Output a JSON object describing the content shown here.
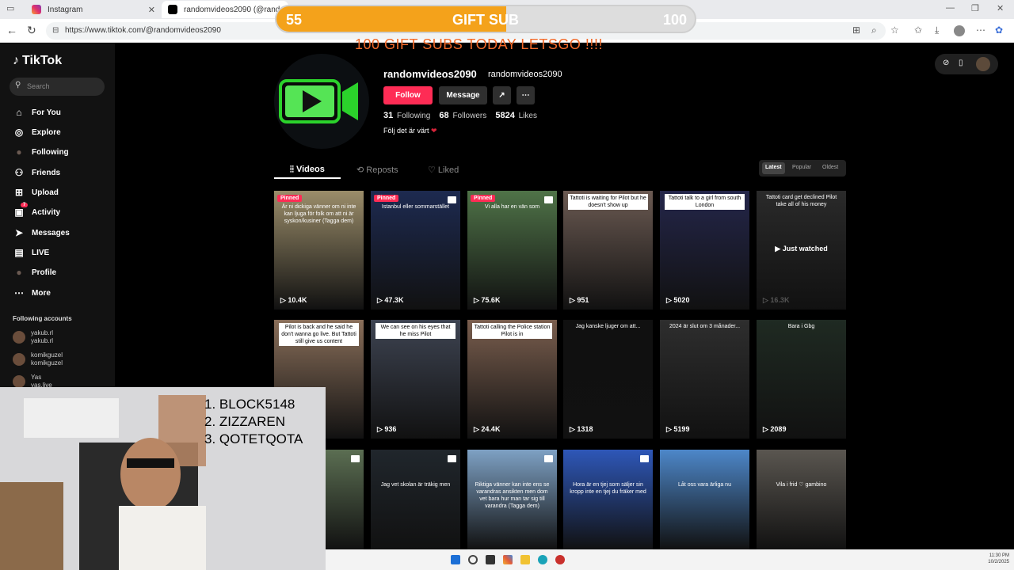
{
  "browser": {
    "tabs": [
      {
        "title": "Instagram"
      },
      {
        "title": "randomvideos2090 (@randomvi"
      }
    ],
    "url": "https://www.tiktok.com/@randomvideos2090"
  },
  "overlay": {
    "gift_start": "55",
    "gift_label": "GIFT SUB",
    "gift_goal": "100",
    "gift_progress_fraction": 0.55,
    "banner": "100 GIFT SUBS TODAY LETSGO !!!!"
  },
  "sidebar": {
    "logo": "TikTok",
    "search_placeholder": "Search",
    "items": [
      {
        "label": "For You",
        "icon": "home-icon"
      },
      {
        "label": "Explore",
        "icon": "compass-icon"
      },
      {
        "label": "Following",
        "icon": "following-icon"
      },
      {
        "label": "Friends",
        "icon": "friends-icon"
      },
      {
        "label": "Upload",
        "icon": "upload-icon"
      },
      {
        "label": "Activity",
        "icon": "activity-icon",
        "badge": "7"
      },
      {
        "label": "Messages",
        "icon": "messages-icon"
      },
      {
        "label": "LIVE",
        "icon": "live-icon"
      },
      {
        "label": "Profile",
        "icon": "avatar"
      },
      {
        "label": "More",
        "icon": "more-icon"
      }
    ],
    "following_header": "Following accounts",
    "accounts": [
      {
        "name": "yakub.rl",
        "handle": "yakub.rl"
      },
      {
        "name": "komikguzel",
        "handle": "komikguzel"
      },
      {
        "name": "Yas",
        "handle": "yas.live"
      }
    ]
  },
  "profile": {
    "name": "randomvideos2090",
    "username": "randomvideos2090",
    "follow_label": "Follow",
    "message_label": "Message",
    "following_count": "31",
    "following_label": "Following",
    "followers_count": "68",
    "followers_label": "Followers",
    "likes_count": "5824",
    "likes_label": "Likes",
    "bio": "Följ det är värt"
  },
  "tabs": [
    {
      "label": "Videos"
    },
    {
      "label": "Reposts"
    },
    {
      "label": "Liked"
    }
  ],
  "sort": [
    {
      "label": "Latest"
    },
    {
      "label": "Popular"
    },
    {
      "label": "Oldest"
    }
  ],
  "videos": [
    {
      "pinned": "Pinned",
      "caption": "Är ni dickiga vänner om ni inte kan ljuga för folk om att ni är syskon/kusiner (Tagga dem)",
      "views": "10.4K",
      "bg": "#9b8d6a"
    },
    {
      "pinned": "Pinned",
      "caption": "Istanbul eller sommarstället",
      "views": "47.3K",
      "bg": "#1d2a50"
    },
    {
      "pinned": "Pinned",
      "caption": "Vi alla har en vän som",
      "views": "75.6K",
      "bg": "#4f7348"
    },
    {
      "caption": "Tattoti is waiting for Pilot but he doesn't show up",
      "views": "951",
      "bg": "#6b5a52"
    },
    {
      "caption": "Tattoti talk to a girl from south London",
      "views": "5020",
      "bg": "#24264a"
    },
    {
      "caption": "Tattoti card get declined Pilot take all of his money",
      "overlay": "Just watched",
      "views": "16.3K",
      "bg": "#2a2a2a"
    },
    {
      "caption": "Pilot is back and he said he don't wanna go live. But Tattoti still give us content",
      "views": "",
      "bg": "#8a6f5a"
    },
    {
      "caption": "We can see on his eyes that he miss Pilot",
      "views": "936",
      "bg": "#3e4452"
    },
    {
      "caption": "Tattoti calling the Police station Pilot is in",
      "views": "24.4K",
      "bg": "#7a5e4e"
    },
    {
      "caption": "Jag kanske ljuger om att...",
      "views": "1318",
      "bg": "#101010"
    },
    {
      "caption": "2024 är slut om 3 månader...",
      "views": "5199",
      "bg": "#2e2e2e"
    },
    {
      "caption": "Bara i Gbg",
      "views": "2089",
      "bg": "#1f2a22"
    },
    {
      "caption": "...",
      "views": "",
      "bg": "#5b6e52"
    },
    {
      "caption": "Jag vet skolan är träkig men",
      "views": "",
      "bg": "#20262c"
    },
    {
      "caption": "Riktiga vänner kan inte ens se varandras ansikten men dom vet bara hur man tar sig till varandra (Tagga dem)",
      "views": "",
      "bg": "#7ea1c4"
    },
    {
      "caption": "Hora är en tjej som säljer sin kropp inte en tjej du fräker med",
      "views": "",
      "bg": "#2e57b8"
    },
    {
      "caption": "Låt oss vara ärliga nu",
      "views": "",
      "bg": "#4d87c9"
    },
    {
      "caption": "Vila i frid ♡ gambino",
      "views": "",
      "bg": "#5a5650"
    }
  ],
  "webcam": {
    "ranks": [
      "1. BLOCK5148",
      "2. ZIZZAREN",
      "3. QOTETQOTA"
    ]
  },
  "taskbar": {
    "time": "11:30 PM",
    "date": "10/2/2025"
  }
}
